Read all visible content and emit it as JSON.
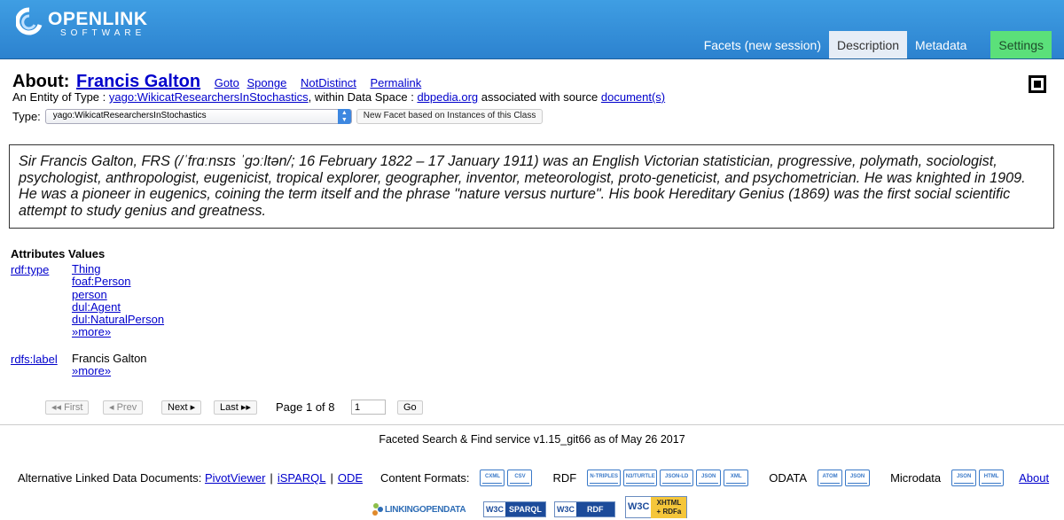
{
  "header": {
    "logo_name": "OPENLINK",
    "logo_sub": "SOFTWARE",
    "tabs": [
      "Facets (new session)",
      "Description",
      "Metadata",
      "Settings"
    ]
  },
  "about": {
    "label": "About:",
    "name": "Francis Galton",
    "links": [
      "Goto",
      "Sponge",
      "NotDistinct",
      "Permalink"
    ],
    "entity_prefix": "An Entity of Type :",
    "entity_type": "yago:WikicatResearchersInStochastics",
    "data_space_prefix": ", within Data Space :",
    "data_space": "dbpedia.org",
    "source_prefix": "associated with source",
    "source_link": "document(s)"
  },
  "type_row": {
    "label": "Type:",
    "selected": "yago:WikicatResearchersInStochastics",
    "button": "New Facet based on Instances of this Class"
  },
  "description": "Sir Francis Galton, FRS (/ˈfrɑːnsɪs ˈɡɔːltən/; 16 February 1822 – 17 January 1911) was an English Victorian statistician, progressive, polymath, sociologist, psychologist, anthropologist, eugenicist, tropical explorer, geographer, inventor, meteorologist, proto-geneticist, and psychometrician. He was knighted in 1909. He was a pioneer in eugenics, coining the term itself and the phrase \"nature versus nurture\". His book Hereditary Genius (1869) was the first social scientific attempt to study genius and greatness.",
  "attributes": {
    "header": "Attributes Values",
    "rows": [
      {
        "property": "rdf:type",
        "values": [
          "Thing",
          "foaf:Person",
          "person",
          "dul:Agent",
          "dul:NaturalPerson",
          "»more»"
        ]
      },
      {
        "property": "rdfs:label",
        "values": [
          "Francis Galton",
          "»more»"
        ]
      }
    ]
  },
  "pager": {
    "first": "◂◂ First",
    "prev": "◂ Prev",
    "next": "Next ▸",
    "last": "Last ▸▸",
    "page_text": "Page 1 of 8",
    "page_value": "1",
    "go": "Go"
  },
  "footer": {
    "service": "Faceted Search & Find service v1.15_git66 as of May 26 2017",
    "alt_label": "Alternative Linked Data Documents:",
    "alt_links": [
      "PivotViewer",
      "iSPARQL",
      "ODE"
    ],
    "content_formats_label": "Content Formats:",
    "formats_main": [
      "CXML",
      "CSV"
    ],
    "rdf_label": "RDF",
    "formats_rdf": [
      "N-TRIPLES",
      "N3/TURTLE",
      "JSON-LD",
      "JSON",
      "XML"
    ],
    "odata_label": "ODATA",
    "formats_odata": [
      "ATOM",
      "JSON"
    ],
    "microdata_label": "Microdata",
    "formats_micro": [
      "JSON",
      "HTML"
    ],
    "about_link": "About",
    "badges": {
      "lod": "LINKINGOPENDATA",
      "w3c": "W3C",
      "sparql": "SPARQL",
      "rdf": "RDF",
      "xhtml": "XHTML + RDFa"
    }
  }
}
